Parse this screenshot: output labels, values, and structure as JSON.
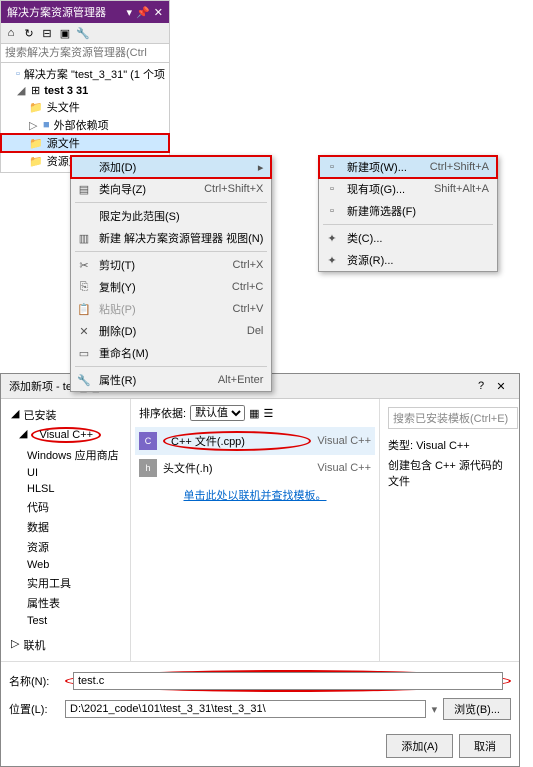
{
  "panel": {
    "title": "解决方案资源管理器",
    "search_placeholder": "搜索解决方案资源管理器(Ctrl",
    "solution": "解决方案 \"test_3_31\" (1 个项",
    "project": "test 3 31",
    "nodes": {
      "headers": "头文件",
      "external": "外部依赖项",
      "source": "源文件",
      "resource": "资源文件"
    }
  },
  "menu1": {
    "add": "添加(D)",
    "wizard": "类向导(Z)",
    "wizard_sc": "Ctrl+Shift+X",
    "scope": "限定为此范围(S)",
    "newview": "新建 解决方案资源管理器 视图(N)",
    "cut": "剪切(T)",
    "cut_sc": "Ctrl+X",
    "copy": "复制(Y)",
    "copy_sc": "Ctrl+C",
    "paste": "粘贴(P)",
    "paste_sc": "Ctrl+V",
    "delete": "删除(D)",
    "delete_sc": "Del",
    "rename": "重命名(M)",
    "props": "属性(R)",
    "props_sc": "Alt+Enter"
  },
  "menu2": {
    "newitem": "新建项(W)...",
    "newitem_sc": "Ctrl+Shift+A",
    "existing": "现有项(G)...",
    "existing_sc": "Shift+Alt+A",
    "newfilter": "新建筛选器(F)",
    "class": "类(C)...",
    "resource": "资源(R)..."
  },
  "dialog": {
    "title": "添加新项 - test_3_31",
    "installed": "已安装",
    "online": "联机",
    "cats": [
      "Visual C++",
      "Windows 应用商店",
      "UI",
      "HLSL",
      "代码",
      "数据",
      "资源",
      "Web",
      "实用工具",
      "属性表",
      "Test"
    ],
    "sort_label": "排序依据:",
    "sort_value": "默认值",
    "search_placeholder": "搜索已安装模板(Ctrl+E)",
    "templates": [
      {
        "icon": "C",
        "label": "C++ 文件(.cpp)",
        "lang": "Visual C++"
      },
      {
        "icon": "h",
        "label": "头文件(.h)",
        "lang": "Visual C++"
      }
    ],
    "right_type_label": "类型:",
    "right_type_value": "Visual C++",
    "right_desc": "创建包含 C++ 源代码的文件",
    "link": "单击此处以联机并查找模板。",
    "name_label": "名称(N):",
    "name_value": "test.c",
    "loc_label": "位置(L):",
    "loc_value": "D:\\2021_code\\101\\test_3_31\\test_3_31\\",
    "browse": "浏览(B)...",
    "add": "添加(A)",
    "cancel": "取消"
  }
}
